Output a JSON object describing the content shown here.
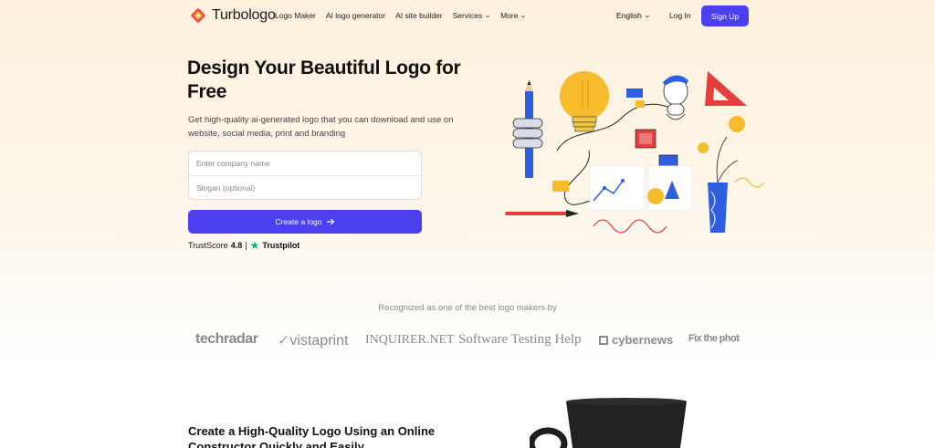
{
  "brand": {
    "name": "Turbologo"
  },
  "nav": {
    "links": [
      {
        "label": "Logo Maker",
        "dropdown": false
      },
      {
        "label": "AI logo generator",
        "dropdown": false
      },
      {
        "label": "AI site builder",
        "dropdown": false
      },
      {
        "label": "Services",
        "dropdown": true
      },
      {
        "label": "More",
        "dropdown": true
      }
    ],
    "language": "English",
    "login": "Log In",
    "signup": "Sign Up"
  },
  "hero": {
    "title": "Design Your Beautiful Logo for Free",
    "subtitle": "Get high-quality ai-generated logo that you can download and use on website, social media, print and branding",
    "company_placeholder": "Enter company name",
    "slogan_placeholder": "Slogan (optional)",
    "cta": "Create a logo",
    "trust_prefix": "TrustScore",
    "trust_score": "4.8",
    "trust_sep": "|",
    "trust_brand": "Trustpilot"
  },
  "recognized": {
    "title": "Recognized as one of the best logo makers by",
    "brands": [
      "techradar",
      "vistaprint",
      "INQUIRER.NET",
      "Software Testing Help",
      "cybernews",
      "Fix the photo"
    ]
  },
  "bottom": {
    "title": "Create a High-Quality Logo Using an Online Constructor Quickly and Easily"
  },
  "colors": {
    "accent": "#4b3ff0",
    "trustpilot": "#00b67a",
    "hero_bg": "#fdf1dd"
  },
  "icons": [
    "turbologo-mark",
    "chevron-down-icon",
    "arrow-right-icon",
    "trustpilot-star-icon"
  ]
}
